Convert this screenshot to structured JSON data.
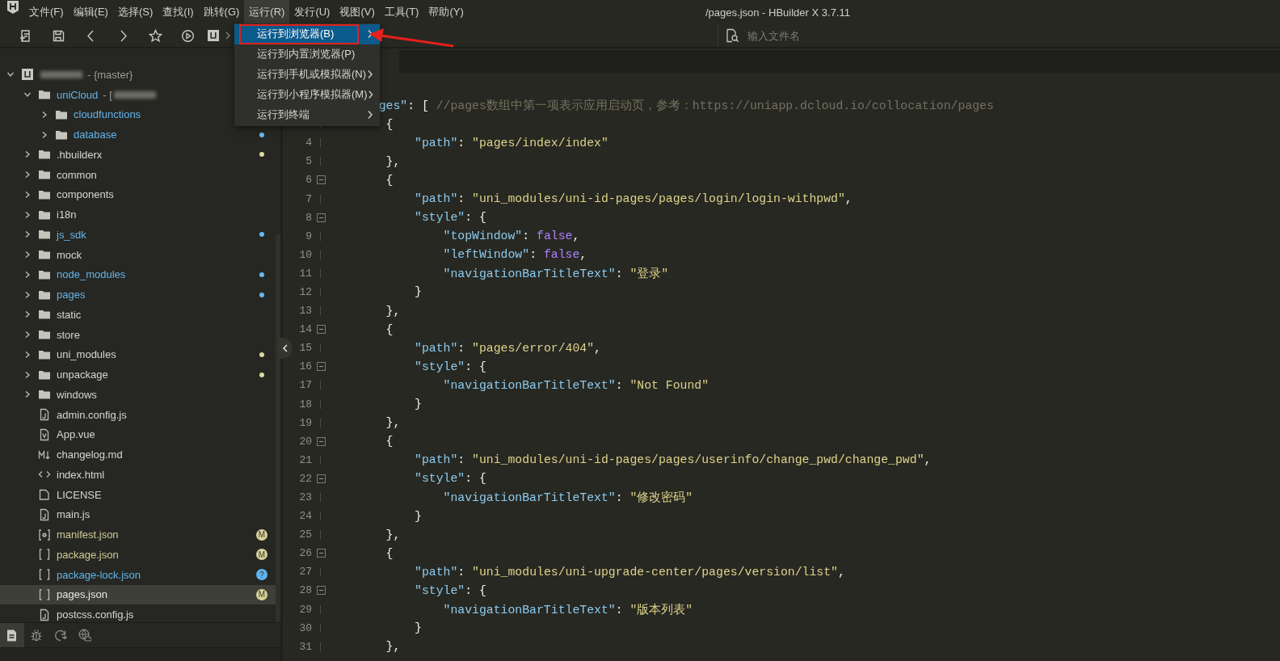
{
  "window": {
    "title": "/pages.json - HBuilder X 3.7.11"
  },
  "menubar": [
    {
      "label": "文件(F)",
      "open": false
    },
    {
      "label": "编辑(E)",
      "open": false
    },
    {
      "label": "选择(S)",
      "open": false
    },
    {
      "label": "查找(I)",
      "open": false
    },
    {
      "label": "跳转(G)",
      "open": false
    },
    {
      "label": "运行(R)",
      "open": true
    },
    {
      "label": "发行(U)",
      "open": false
    },
    {
      "label": "视图(V)",
      "open": false
    },
    {
      "label": "工具(T)",
      "open": false
    },
    {
      "label": "帮助(Y)",
      "open": false
    }
  ],
  "toolbar": {
    "search": {
      "placeholder": "输入文件名"
    }
  },
  "run_menu": {
    "items": [
      {
        "label": "运行到浏览器(B)",
        "selected": true,
        "submenu": true,
        "annotated": true
      },
      {
        "label": "运行到内置浏览器(P)",
        "selected": false,
        "submenu": false,
        "annotated": false
      },
      {
        "label": "运行到手机或模拟器(N)",
        "selected": false,
        "submenu": true,
        "annotated": false
      },
      {
        "label": "运行到小程序模拟器(M)",
        "selected": false,
        "submenu": true,
        "annotated": false
      },
      {
        "label": "运行到终端",
        "selected": false,
        "submenu": true,
        "annotated": false
      }
    ]
  },
  "sidebar": {
    "tree": [
      {
        "kind": "project",
        "note": "- {master}",
        "redacted": true,
        "expanded": true,
        "selected": false,
        "children": [
          {
            "kind": "folder",
            "label": "uniCloud",
            "note": "- [",
            "redacted": true,
            "color": "#62b4ec",
            "expanded": true,
            "selected": false,
            "children": [
              {
                "kind": "folder",
                "label": "cloudfunctions",
                "color": "#62b4ec",
                "expanded": false,
                "selected": false
              },
              {
                "kind": "folder",
                "label": "database",
                "color": "#62b4ec",
                "expanded": false,
                "selected": false,
                "badge": {
                  "kind": "dot",
                  "color": "#6ab8f0"
                }
              }
            ]
          },
          {
            "kind": "folder",
            "label": ".hbuilderx",
            "color": "#d6d6d0",
            "expanded": false,
            "selected": false,
            "badge": {
              "kind": "dot",
              "color": "#ddd7a0"
            }
          },
          {
            "kind": "folder",
            "label": "common",
            "color": "#d6d6d0",
            "expanded": false,
            "selected": false
          },
          {
            "kind": "folder",
            "label": "components",
            "color": "#d6d6d0",
            "expanded": false,
            "selected": false
          },
          {
            "kind": "folder",
            "label": "i18n",
            "color": "#d6d6d0",
            "expanded": false,
            "selected": false
          },
          {
            "kind": "folder",
            "label": "js_sdk",
            "color": "#62b4ec",
            "expanded": false,
            "selected": false,
            "badge": {
              "kind": "dot",
              "color": "#6ab8f0"
            }
          },
          {
            "kind": "folder",
            "label": "mock",
            "color": "#d6d6d0",
            "expanded": false,
            "selected": false
          },
          {
            "kind": "folder",
            "label": "node_modules",
            "color": "#62b4ec",
            "expanded": false,
            "selected": false,
            "badge": {
              "kind": "dot",
              "color": "#6ab8f0"
            }
          },
          {
            "kind": "folder",
            "label": "pages",
            "color": "#62b4ec",
            "expanded": false,
            "selected": false,
            "badge": {
              "kind": "dot",
              "color": "#6ab8f0"
            }
          },
          {
            "kind": "folder",
            "label": "static",
            "color": "#d6d6d0",
            "expanded": false,
            "selected": false
          },
          {
            "kind": "folder",
            "label": "store",
            "color": "#d6d6d0",
            "expanded": false,
            "selected": false
          },
          {
            "kind": "folder",
            "label": "uni_modules",
            "color": "#d6d6d0",
            "expanded": false,
            "selected": false,
            "badge": {
              "kind": "dot",
              "color": "#ddd7a0"
            }
          },
          {
            "kind": "folder",
            "label": "unpackage",
            "color": "#d6d6d0",
            "expanded": false,
            "selected": false,
            "badge": {
              "kind": "dot",
              "color": "#ddd7a0"
            }
          },
          {
            "kind": "folder",
            "label": "windows",
            "color": "#d6d6d0",
            "expanded": false,
            "selected": false
          },
          {
            "kind": "js",
            "label": "admin.config.js",
            "color": "#d6d6d0",
            "selected": false
          },
          {
            "kind": "vue",
            "label": "App.vue",
            "color": "#d6d6d0",
            "selected": false
          },
          {
            "kind": "md",
            "label": "changelog.md",
            "color": "#d6d6d0",
            "selected": false
          },
          {
            "kind": "html",
            "label": "index.html",
            "color": "#d6d6d0",
            "selected": false
          },
          {
            "kind": "file",
            "label": "LICENSE",
            "color": "#d6d6d0",
            "selected": false
          },
          {
            "kind": "js",
            "label": "main.js",
            "color": "#d6d6d0",
            "selected": false
          },
          {
            "kind": "config",
            "label": "manifest.json",
            "color": "#cfcb98",
            "selected": false,
            "badge": {
              "kind": "letter",
              "text": "M",
              "color": "#d9d29a"
            }
          },
          {
            "kind": "json",
            "label": "package.json",
            "color": "#cfcb98",
            "selected": false,
            "badge": {
              "kind": "letter",
              "text": "M",
              "color": "#d9d29a"
            }
          },
          {
            "kind": "json",
            "label": "package-lock.json",
            "color": "#62b4ec",
            "selected": false,
            "badge": {
              "kind": "letter",
              "text": "?",
              "color": "#5fb4f0"
            }
          },
          {
            "kind": "json",
            "label": "pages.json",
            "color": "#e8e8e2",
            "selected": true,
            "badge": {
              "kind": "letter",
              "text": "M",
              "color": "#d9d29a"
            }
          },
          {
            "kind": "js",
            "label": "postcss.config.js",
            "color": "#d6d6d0",
            "selected": false
          }
        ]
      }
    ],
    "tabs": [
      {
        "kind": "files",
        "selected": true
      },
      {
        "kind": "debug",
        "selected": false
      },
      {
        "kind": "sync",
        "selected": false
      },
      {
        "kind": "web",
        "selected": false
      }
    ]
  },
  "editor": {
    "lines": [
      {
        "fold": false,
        "tokens": [
          {
            "kind": "key",
            "text": "   ges\""
          },
          {
            "kind": "punct",
            "text": ": [ "
          },
          {
            "kind": "comment",
            "text": "//pages数组中第一项表示应用启动页，参考：https://uniapp.dcloud.io/collocation/pages"
          }
        ]
      },
      {
        "fold": false,
        "tokens": [
          {
            "kind": "punct",
            "text": "    {"
          }
        ]
      },
      {
        "number": "4",
        "fold": false,
        "tokens": [
          {
            "kind": "key",
            "text": "        \"path\""
          },
          {
            "kind": "punct",
            "text": ": "
          },
          {
            "kind": "string",
            "text": "\"pages/index/index\""
          }
        ]
      },
      {
        "number": "5",
        "fold": false,
        "tokens": [
          {
            "kind": "punct",
            "text": "    },"
          }
        ]
      },
      {
        "number": "6",
        "fold": true,
        "tokens": [
          {
            "kind": "punct",
            "text": "    {"
          }
        ]
      },
      {
        "number": "7",
        "fold": false,
        "tokens": [
          {
            "kind": "key",
            "text": "        \"path\""
          },
          {
            "kind": "punct",
            "text": ": "
          },
          {
            "kind": "string",
            "text": "\"uni_modules/uni-id-pages/pages/login/login-withpwd\""
          },
          {
            "kind": "punct",
            "text": ","
          }
        ]
      },
      {
        "number": "8",
        "fold": true,
        "tokens": [
          {
            "kind": "key",
            "text": "        \"style\""
          },
          {
            "kind": "punct",
            "text": ": {"
          }
        ]
      },
      {
        "number": "9",
        "fold": false,
        "tokens": [
          {
            "kind": "key",
            "text": "            \"topWindow\""
          },
          {
            "kind": "punct",
            "text": ": "
          },
          {
            "kind": "bool",
            "text": "false"
          },
          {
            "kind": "punct",
            "text": ","
          }
        ]
      },
      {
        "number": "10",
        "fold": false,
        "tokens": [
          {
            "kind": "key",
            "text": "            \"leftWindow\""
          },
          {
            "kind": "punct",
            "text": ": "
          },
          {
            "kind": "bool",
            "text": "false"
          },
          {
            "kind": "punct",
            "text": ","
          }
        ]
      },
      {
        "number": "11",
        "fold": false,
        "tokens": [
          {
            "kind": "key",
            "text": "            \"navigationBarTitleText\""
          },
          {
            "kind": "punct",
            "text": ": "
          },
          {
            "kind": "string",
            "text": "\"登录\""
          }
        ]
      },
      {
        "number": "12",
        "fold": false,
        "tokens": [
          {
            "kind": "punct",
            "text": "        }"
          }
        ]
      },
      {
        "number": "13",
        "fold": false,
        "tokens": [
          {
            "kind": "punct",
            "text": "    },"
          }
        ]
      },
      {
        "number": "14",
        "fold": true,
        "tokens": [
          {
            "kind": "punct",
            "text": "    {"
          }
        ]
      },
      {
        "number": "15",
        "fold": false,
        "tokens": [
          {
            "kind": "key",
            "text": "        \"path\""
          },
          {
            "kind": "punct",
            "text": ": "
          },
          {
            "kind": "string",
            "text": "\"pages/error/404\""
          },
          {
            "kind": "punct",
            "text": ","
          }
        ]
      },
      {
        "number": "16",
        "fold": true,
        "tokens": [
          {
            "kind": "key",
            "text": "        \"style\""
          },
          {
            "kind": "punct",
            "text": ": {"
          }
        ]
      },
      {
        "number": "17",
        "fold": false,
        "tokens": [
          {
            "kind": "key",
            "text": "            \"navigationBarTitleText\""
          },
          {
            "kind": "punct",
            "text": ": "
          },
          {
            "kind": "string",
            "text": "\"Not Found\""
          }
        ]
      },
      {
        "number": "18",
        "fold": false,
        "tokens": [
          {
            "kind": "punct",
            "text": "        }"
          }
        ]
      },
      {
        "number": "19",
        "fold": false,
        "tokens": [
          {
            "kind": "punct",
            "text": "    },"
          }
        ]
      },
      {
        "number": "20",
        "fold": true,
        "tokens": [
          {
            "kind": "punct",
            "text": "    {"
          }
        ]
      },
      {
        "number": "21",
        "fold": false,
        "tokens": [
          {
            "kind": "key",
            "text": "        \"path\""
          },
          {
            "kind": "punct",
            "text": ": "
          },
          {
            "kind": "string",
            "text": "\"uni_modules/uni-id-pages/pages/userinfo/change_pwd/change_pwd\""
          },
          {
            "kind": "punct",
            "text": ","
          }
        ]
      },
      {
        "number": "22",
        "fold": true,
        "tokens": [
          {
            "kind": "key",
            "text": "        \"style\""
          },
          {
            "kind": "punct",
            "text": ": {"
          }
        ]
      },
      {
        "number": "23",
        "fold": false,
        "tokens": [
          {
            "kind": "key",
            "text": "            \"navigationBarTitleText\""
          },
          {
            "kind": "punct",
            "text": ": "
          },
          {
            "kind": "string",
            "text": "\"修改密码\""
          }
        ]
      },
      {
        "number": "24",
        "fold": false,
        "tokens": [
          {
            "kind": "punct",
            "text": "        }"
          }
        ]
      },
      {
        "number": "25",
        "fold": false,
        "tokens": [
          {
            "kind": "punct",
            "text": "    },"
          }
        ]
      },
      {
        "number": "26",
        "fold": true,
        "tokens": [
          {
            "kind": "punct",
            "text": "    {"
          }
        ]
      },
      {
        "number": "27",
        "fold": false,
        "tokens": [
          {
            "kind": "key",
            "text": "        \"path\""
          },
          {
            "kind": "punct",
            "text": ": "
          },
          {
            "kind": "string",
            "text": "\"uni_modules/uni-upgrade-center/pages/version/list\""
          },
          {
            "kind": "punct",
            "text": ","
          }
        ]
      },
      {
        "number": "28",
        "fold": true,
        "tokens": [
          {
            "kind": "key",
            "text": "        \"style\""
          },
          {
            "kind": "punct",
            "text": ": {"
          }
        ]
      },
      {
        "number": "29",
        "fold": false,
        "tokens": [
          {
            "kind": "key",
            "text": "            \"navigationBarTitleText\""
          },
          {
            "kind": "punct",
            "text": ": "
          },
          {
            "kind": "string",
            "text": "\"版本列表\""
          }
        ]
      },
      {
        "number": "30",
        "fold": false,
        "tokens": [
          {
            "kind": "punct",
            "text": "        }"
          }
        ]
      },
      {
        "number": "31",
        "fold": false,
        "tokens": [
          {
            "kind": "punct",
            "text": "    },"
          }
        ]
      }
    ]
  }
}
